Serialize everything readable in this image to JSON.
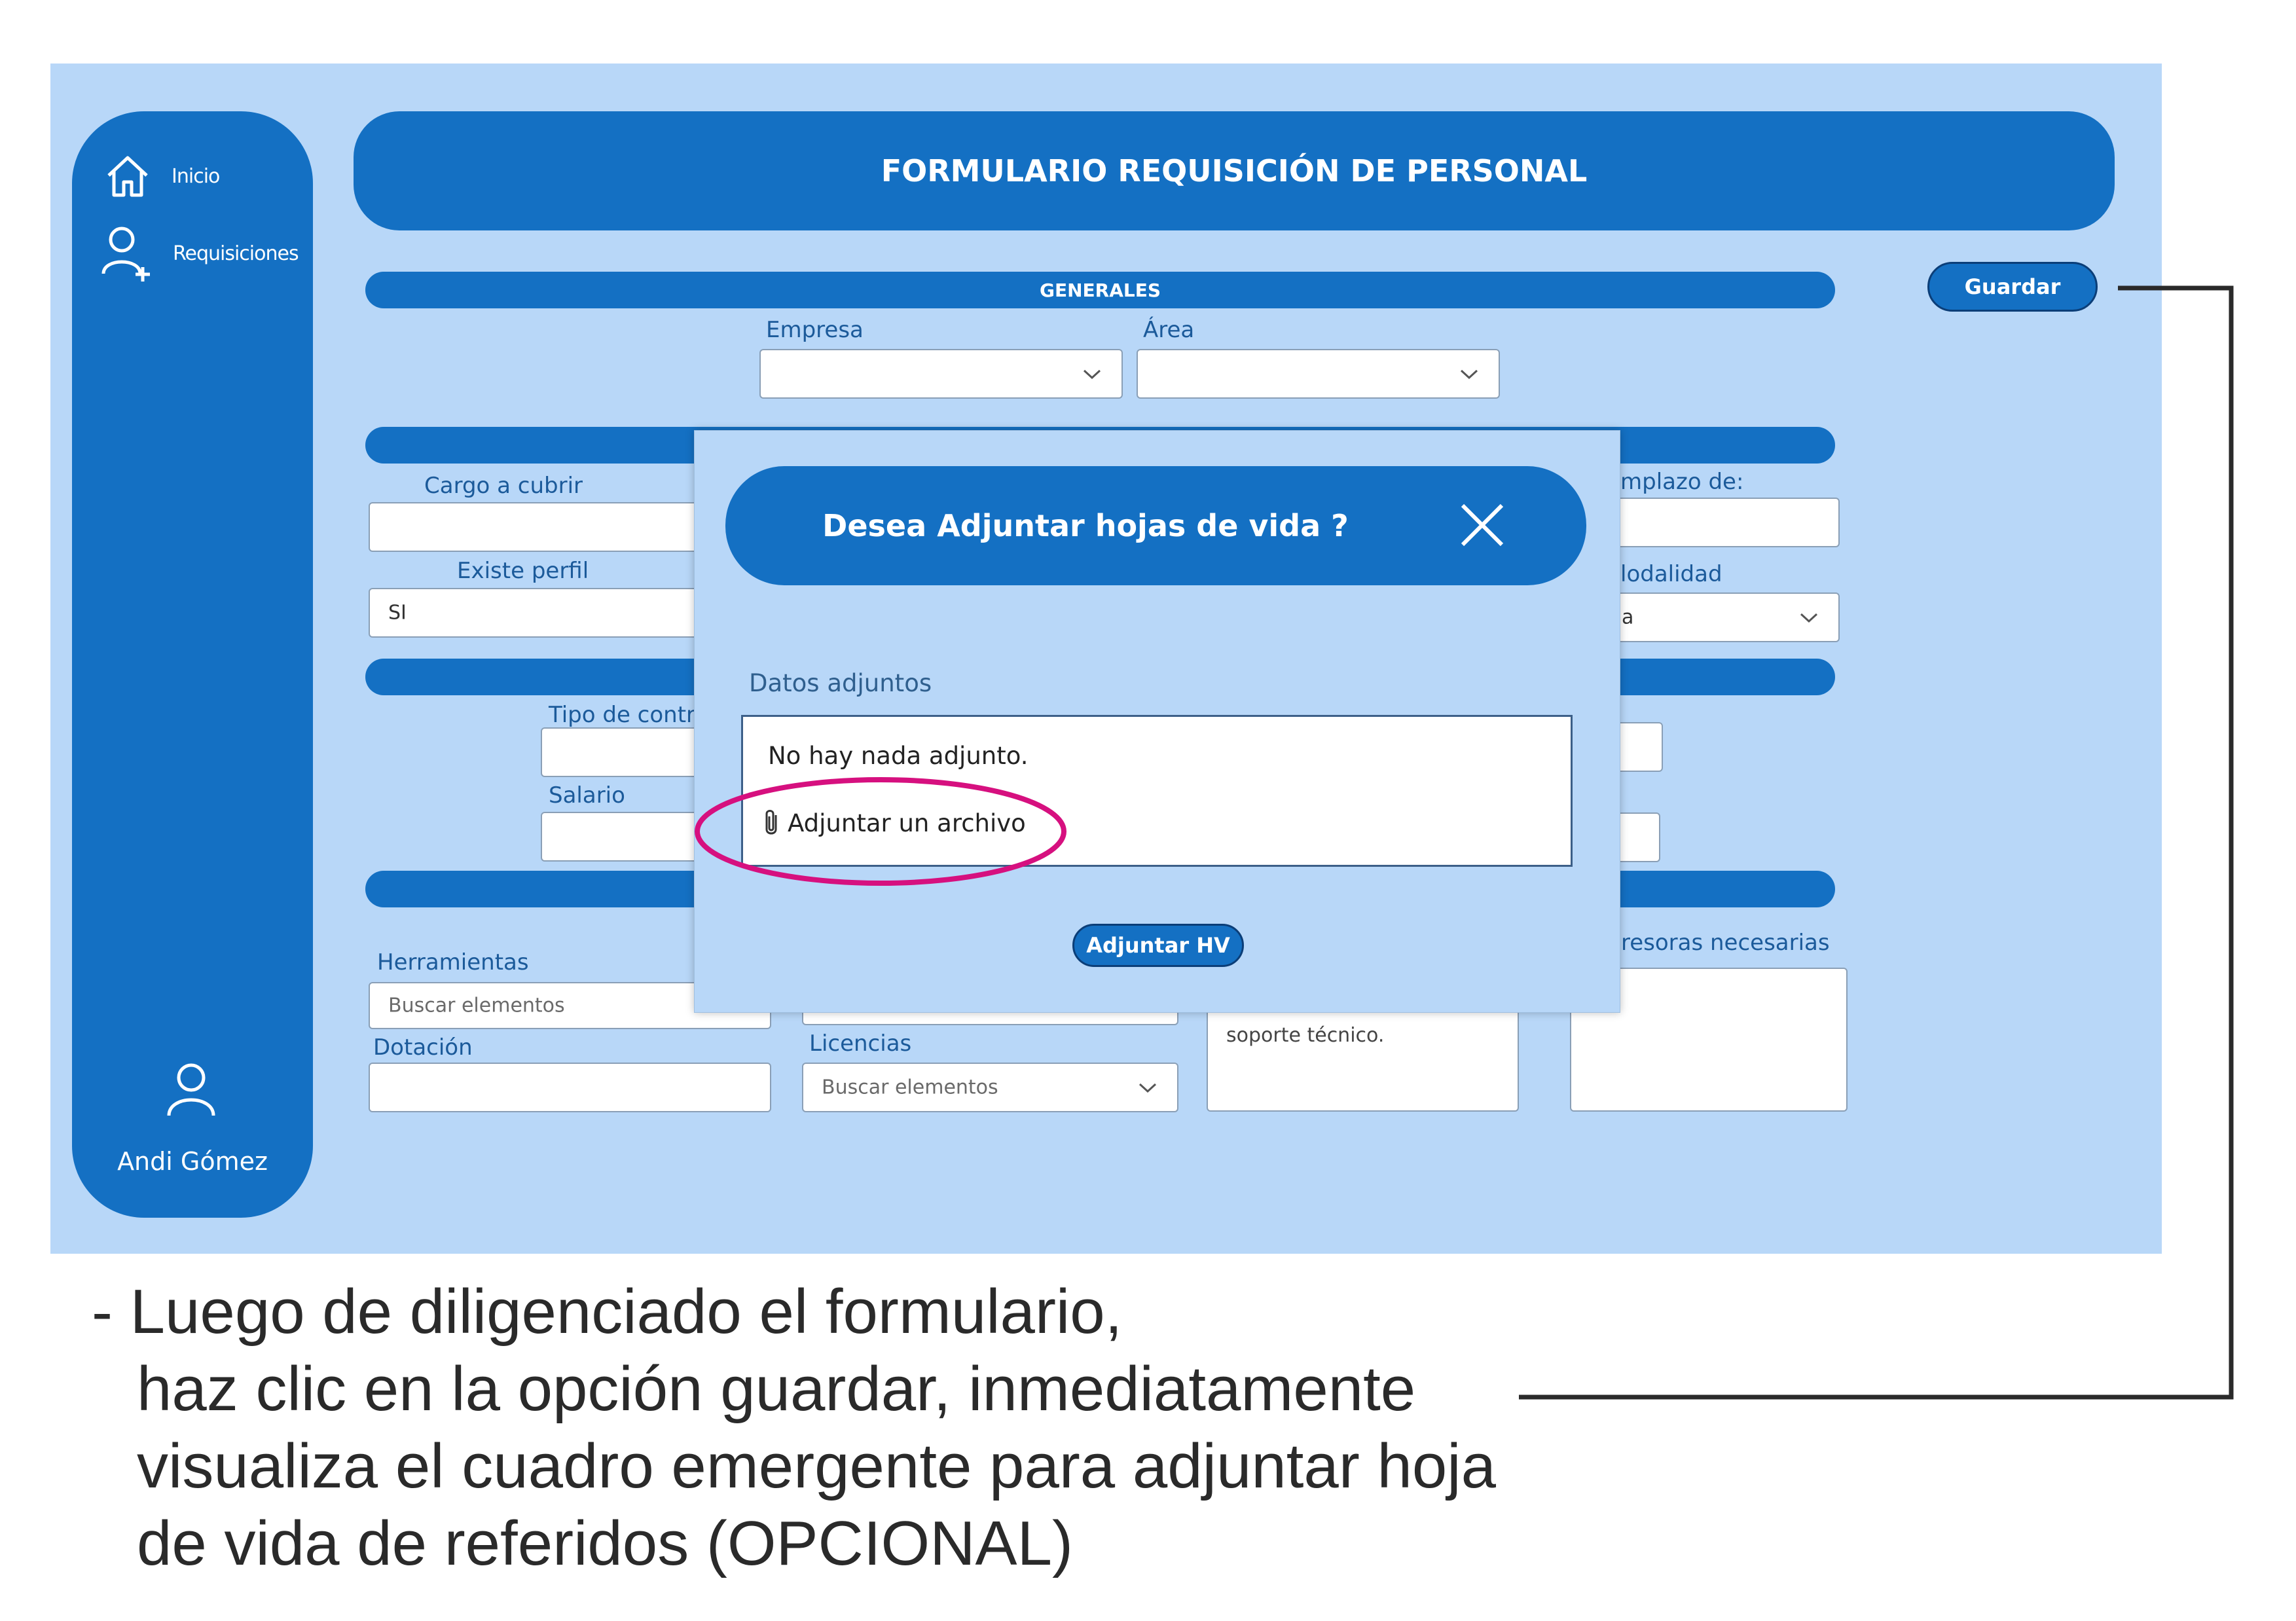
{
  "sidebar": {
    "items": [
      {
        "label": "Inicio",
        "icon": "home-icon"
      },
      {
        "label": "Requisiciones",
        "icon": "user-add-icon"
      }
    ],
    "user": {
      "name": "Andi Gómez",
      "icon": "user-icon"
    }
  },
  "header": {
    "title": "FORMULARIO REQUISICIÓN DE PERSONAL"
  },
  "toolbar": {
    "save_label": "Guardar"
  },
  "sections": {
    "generales": {
      "title": "GENERALES",
      "empresa_label": "Empresa",
      "area_label": "Área"
    },
    "cargo": {
      "cargo_label": "Cargo a cubrir",
      "perfil_label": "Existe perfil",
      "perfil_value": "SI",
      "reemplazo_label": "mplazo de:",
      "modalidad_label": "lodalidad",
      "modalidad_value": "a"
    },
    "contrato": {
      "tipo_label": "Tipo de contr",
      "salario_label": "Salario"
    },
    "recursos": {
      "herramientas_label": "Herramientas",
      "herramientas_placeholder": "Buscar elementos",
      "dotacion_label": "Dotación",
      "licencias_label": "Licencias",
      "licencias_placeholder": "Buscar elementos",
      "soporte_text": "soporte técnico.",
      "impresoras_label": "resoras necesarias"
    }
  },
  "modal": {
    "title": "Desea Adjuntar hojas de vida ?",
    "attachments_label": "Datos adjuntos",
    "empty_text": "No hay nada adjunto.",
    "attach_link": "Adjuntar un archivo",
    "submit_label": "Adjuntar HV"
  },
  "instructions": {
    "lines": [
      "- Luego de diligenciado el formulario,",
      "haz clic en la opción guardar, inmediatamente",
      "visualiza el cuadro emergente para adjuntar hoja",
      "de vida de referidos (OPCIONAL)"
    ]
  },
  "colors": {
    "accent": "#1470c3",
    "background": "#b8d7f8",
    "highlight": "#d6107f",
    "callout_line": "#2a2a2a"
  }
}
